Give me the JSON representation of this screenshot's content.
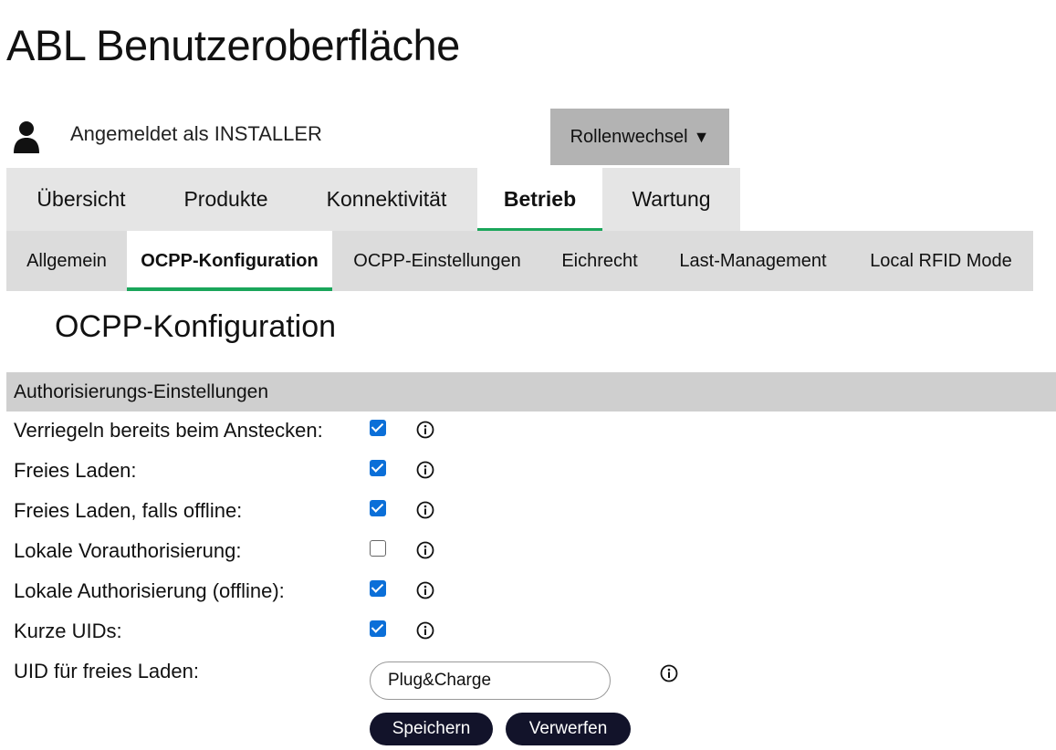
{
  "app": {
    "title": "ABL Benutzeroberfläche"
  },
  "user": {
    "logged_in_text": "Angemeldet als INSTALLER",
    "icon": "person-icon"
  },
  "role_switch": {
    "label": "Rollenwechsel",
    "caret": "▼"
  },
  "main_tabs": [
    {
      "label": "Übersicht",
      "active": false
    },
    {
      "label": "Produkte",
      "active": false
    },
    {
      "label": "Konnektivität",
      "active": false
    },
    {
      "label": "Betrieb",
      "active": true
    },
    {
      "label": "Wartung",
      "active": false
    }
  ],
  "sub_tabs": [
    {
      "label": "Allgemein",
      "active": false
    },
    {
      "label": "OCPP-Konfiguration",
      "active": true
    },
    {
      "label": "OCPP-Einstellungen",
      "active": false
    },
    {
      "label": "Eichrecht",
      "active": false
    },
    {
      "label": "Last-Management",
      "active": false
    },
    {
      "label": "Local RFID Mode",
      "active": false
    }
  ],
  "page": {
    "title": "OCPP-Konfiguration",
    "section_title": "Authorisierungs-Einstellungen",
    "settings": [
      {
        "label": "Verriegeln bereits beim Anstecken:",
        "checked": true
      },
      {
        "label": "Freies Laden:",
        "checked": true
      },
      {
        "label": "Freies Laden, falls offline:",
        "checked": true
      },
      {
        "label": "Lokale Vorauthorisierung:",
        "checked": false
      },
      {
        "label": "Lokale Authorisierung (offline):",
        "checked": true
      },
      {
        "label": "Kurze UIDs:",
        "checked": true
      }
    ],
    "uid_field": {
      "label": "UID für freies Laden:",
      "value": "Plug&Charge"
    },
    "buttons": {
      "save": "Speichern",
      "discard": "Verwerfen"
    }
  },
  "colors": {
    "accent_green": "#1aa65a",
    "checkbox_blue": "#0b6fd8",
    "button_dark": "#12132a"
  }
}
